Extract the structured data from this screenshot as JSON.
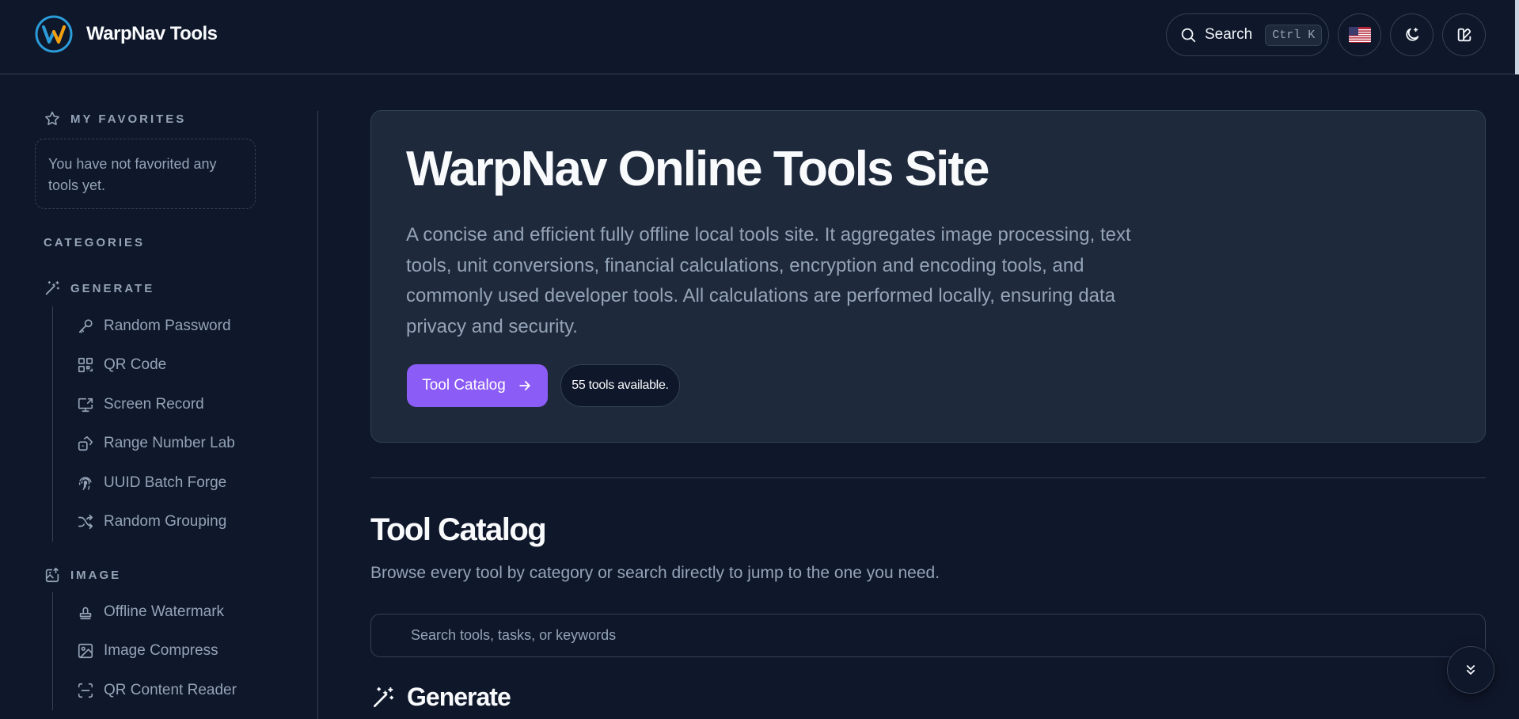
{
  "header": {
    "brand": "WarpNav Tools",
    "search_label": "Search",
    "search_shortcut": "Ctrl K"
  },
  "sidebar": {
    "favorites_title": "MY FAVORITES",
    "favorites_empty": "You have not favorited any tools yet.",
    "categories_title": "CATEGORIES",
    "groups": [
      {
        "title": "GENERATE",
        "icon": "wand-icon",
        "items": [
          {
            "label": "Random Password",
            "icon": "key-icon"
          },
          {
            "label": "QR Code",
            "icon": "qr-code-icon"
          },
          {
            "label": "Screen Record",
            "icon": "screen-share-icon"
          },
          {
            "label": "Range Number Lab",
            "icon": "dice-icon"
          },
          {
            "label": "UUID Batch Forge",
            "icon": "fingerprint-icon"
          },
          {
            "label": "Random Grouping",
            "icon": "shuffle-icon"
          }
        ]
      },
      {
        "title": "IMAGE",
        "icon": "image-upload-icon",
        "items": [
          {
            "label": "Offline Watermark",
            "icon": "stamp-icon"
          },
          {
            "label": "Image Compress",
            "icon": "image-icon"
          },
          {
            "label": "QR Content Reader",
            "icon": "scan-icon"
          }
        ]
      }
    ]
  },
  "hero": {
    "title": "WarpNav Online Tools Site",
    "description": "A concise and efficient fully offline local tools site. It aggregates image processing, text tools, unit conversions, financial calculations, encryption and encoding tools, and commonly used developer tools. All calculations are performed locally, ensuring data privacy and security.",
    "cta_label": "Tool Catalog",
    "tools_count": "55 tools available."
  },
  "catalog": {
    "title": "Tool Catalog",
    "subtitle": "Browse every tool by category or search directly to jump to the one you need.",
    "search_placeholder": "Search tools, tasks, or keywords",
    "first_category": "Generate"
  },
  "colors": {
    "background": "#0f172a",
    "card": "#1e293b",
    "border": "#334155",
    "accent": "#8b5cf6",
    "muted_text": "#94a3b8"
  }
}
